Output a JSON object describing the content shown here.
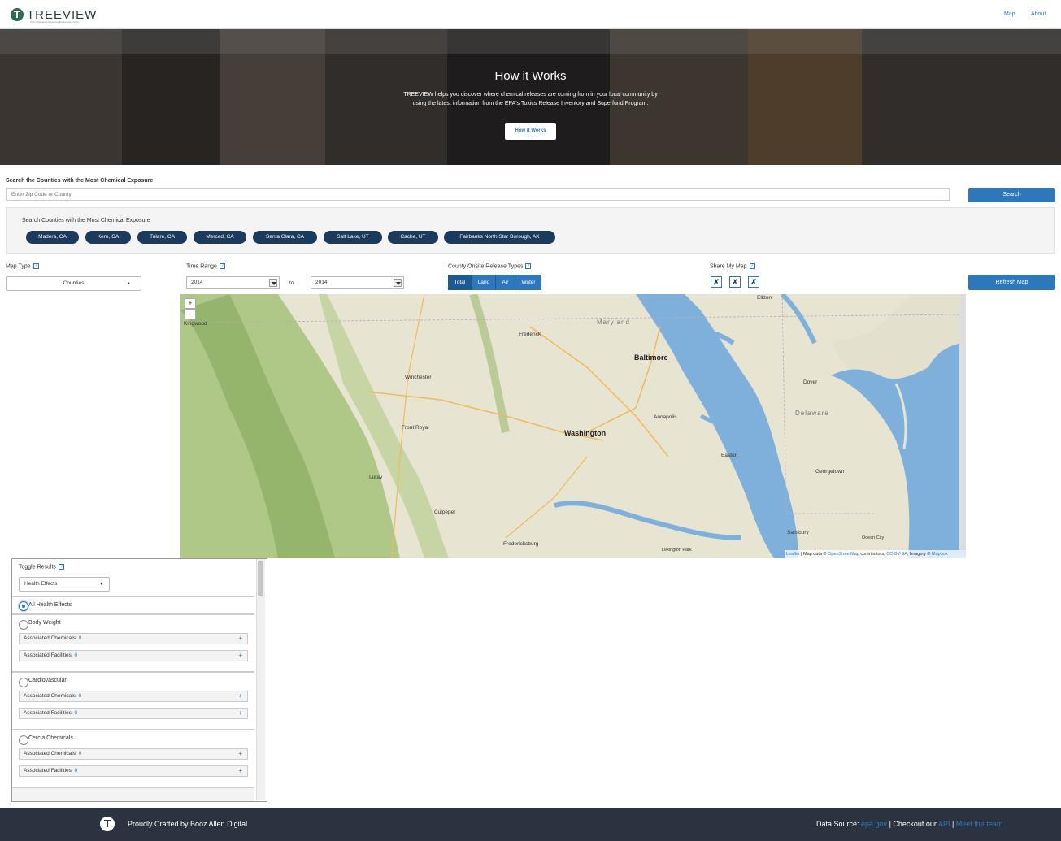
{
  "header": {
    "logo": "TREEVIEW",
    "logo_subtitle": "Toxic Release & Exposure Environment View",
    "nav": [
      "Map",
      "About"
    ]
  },
  "hero": {
    "title": "How it Works",
    "text": "TREEVIEW helps you discover where chemical releases are coming from in your local community by using the latest information from the EPA's Toxics Release Inventory and Superfund Program.",
    "button": "How it Works"
  },
  "search": {
    "label": "Search the Counties with the Most Chemical Exposure",
    "placeholder": "Enter Zip Code or County",
    "button": "Search",
    "chips_title": "Search Counties with the Most Chemical Exposure",
    "chips": [
      "Madera, CA",
      "Kern, CA",
      "Tulare, CA",
      "Merced, CA",
      "Santa Clara, CA",
      "Salt Lake, UT",
      "Cache, UT",
      "Fairbanks North Star Borough, AK"
    ]
  },
  "controls": {
    "map_type_label": "Map Type",
    "map_type_value": "Counties",
    "time_range_label": "Time Range",
    "time_from": "2014",
    "time_to_label": "to",
    "time_to": "2014",
    "release_types_label": "County Onsite Release Types",
    "release_types": [
      "Total",
      "Land",
      "Air",
      "Water"
    ],
    "share_label": "Share My Map",
    "refresh_button": "Refresh Map"
  },
  "map": {
    "zoom_in": "+",
    "zoom_out": "-",
    "labels": {
      "maryland": "Maryland",
      "delaware": "Delaware",
      "baltimore": "Baltimore",
      "washington": "Washington",
      "annapolis": "Annapolis",
      "frederick": "Frederick",
      "winchester": "Winchester",
      "front_royal": "Front Royal",
      "luray": "Luray",
      "culpeper": "Culpeper",
      "fredericksburg": "Fredericksburg",
      "dover": "Dover",
      "georgetown": "Georgetown",
      "easton": "Easton",
      "salisbury": "Salisbury",
      "ocean_city": "Ocean City",
      "elkton": "Elkton",
      "kingwood": "Kingwood",
      "lexington_park": "Lexington Park"
    },
    "attribution": {
      "leaflet": "Leaflet",
      "mid": " | Map data © ",
      "osm": "OpenStreetMap",
      "contrib": " contributors, ",
      "license": "CC-BY-SA",
      "imagery": ", Imagery © ",
      "mapbox": "Mapbox"
    }
  },
  "results": {
    "toggle_label": "Toggle Results",
    "filter_value": "Health Effects",
    "all_label": "All Health Effects",
    "chem_label": "Associated Chemicals:",
    "fac_label": "Associated Facilities:",
    "effects": [
      {
        "name": "Body Weight",
        "chemicals": "0",
        "facilities": "0"
      },
      {
        "name": "Cardiovascular",
        "chemicals": "0",
        "facilities": "0"
      },
      {
        "name": "Cercla Chemicals",
        "chemicals": "0",
        "facilities": "0"
      }
    ]
  },
  "footer": {
    "crafted": "Proudly Crafted by Booz Allen Digital",
    "source_label": "Data Source: ",
    "source_link": "epa.gov",
    "sep1": " | Checkout our ",
    "api": "API",
    "sep2": " | ",
    "team": "Meet the team"
  },
  "colors": {
    "accent": "#2e77bc",
    "chip": "#1b3a5c",
    "footer": "#2b3340",
    "water": "#6fa8dc"
  }
}
